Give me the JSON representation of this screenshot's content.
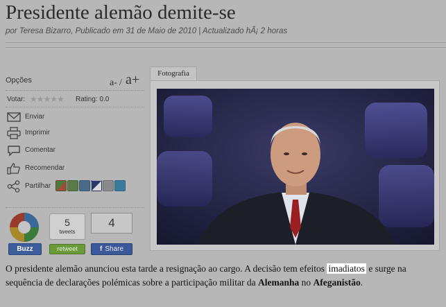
{
  "article": {
    "title": "Presidente alemão demite-se",
    "byline": "por Teresa Bizarro, Publicado em 31 de Maio de 2010  |  Actualizado hÃ¡ 2 horas",
    "photo_tab": "Fotografia",
    "body_part1": "O presidente alemão anunciou esta tarde a resignação ao cargo. A decisão tem efeitos ",
    "body_highlight": "imadiatos",
    "body_part2": " e surge na sequência de declarações polémicas sobre a participação militar da ",
    "body_bold1": "Alemanha",
    "body_part3": " no ",
    "body_bold2": "Afeganistão",
    "body_part4": "."
  },
  "options": {
    "label": "Opções",
    "font_small": "a-",
    "font_sep": "/",
    "font_big": "a+",
    "vote_label": "Votar:",
    "rating_text": "Rating: 0.0",
    "stars": 5,
    "actions": [
      {
        "label": "Enviar",
        "icon": "envelope-icon"
      },
      {
        "label": "Imprimir",
        "icon": "printer-icon"
      },
      {
        "label": "Comentar",
        "icon": "comment-icon"
      },
      {
        "label": "Recomendar",
        "icon": "thumbs-up-icon"
      },
      {
        "label": "Partilhar",
        "icon": "share-icon"
      }
    ]
  },
  "social": {
    "buzz_label": "Buzz",
    "tweets_count": "5",
    "tweets_label": "tweets",
    "retweet_label": "retweet",
    "facebook_count": "4",
    "facebook_f": "f",
    "facebook_share_label": "Share"
  },
  "colors": {
    "overlay_background": "#b7b7b7",
    "highlight": "#ffffff",
    "facebook_blue": "#3b5998",
    "retweet_green": "#6a9a3a"
  }
}
